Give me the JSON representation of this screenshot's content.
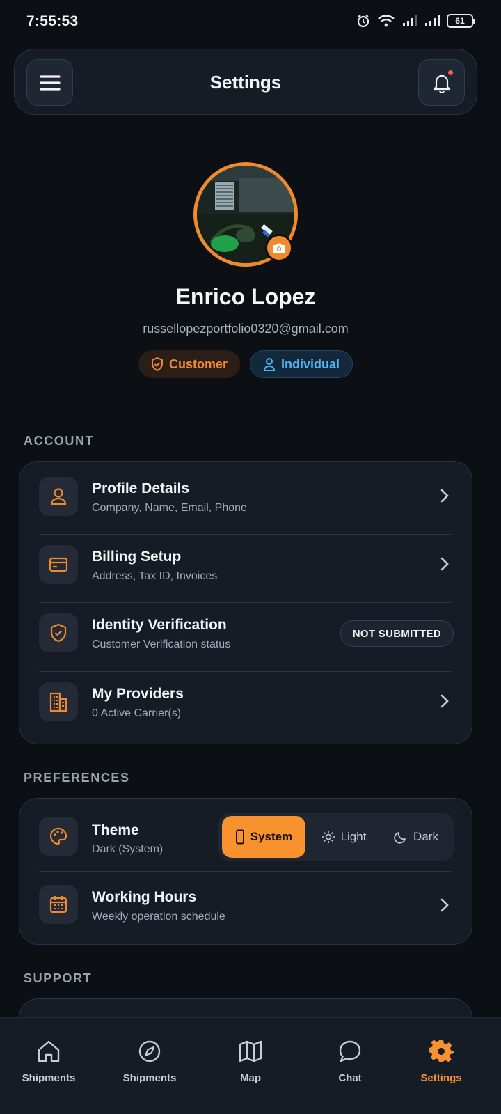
{
  "status_bar": {
    "time": "7:55:53",
    "battery": "61"
  },
  "header": {
    "title": "Settings"
  },
  "profile": {
    "name": "Enrico Lopez",
    "email": "russellopezportfolio0320@gmail.com",
    "badges": {
      "role": "Customer",
      "type": "Individual"
    }
  },
  "sections": {
    "account": {
      "label": "ACCOUNT",
      "items": [
        {
          "title": "Profile Details",
          "subtitle": "Company, Name, Email, Phone"
        },
        {
          "title": "Billing Setup",
          "subtitle": "Address, Tax ID, Invoices"
        },
        {
          "title": "Identity Verification",
          "subtitle": "Customer Verification status",
          "status": "NOT SUBMITTED"
        },
        {
          "title": "My Providers",
          "subtitle": "0 Active Carrier(s)"
        }
      ]
    },
    "preferences": {
      "label": "PREFERENCES",
      "theme": {
        "title": "Theme",
        "subtitle": "Dark (System)",
        "options": [
          "System",
          "Light",
          "Dark"
        ],
        "selected": "System"
      },
      "working_hours": {
        "title": "Working Hours",
        "subtitle": "Weekly operation schedule"
      }
    },
    "support": {
      "label": "SUPPORT"
    }
  },
  "bottom_nav": {
    "items": [
      {
        "label": "Shipments",
        "icon": "home-icon"
      },
      {
        "label": "Shipments",
        "icon": "compass-icon"
      },
      {
        "label": "Map",
        "icon": "map-icon"
      },
      {
        "label": "Chat",
        "icon": "chat-icon"
      },
      {
        "label": "Settings",
        "icon": "gear-icon",
        "active": true
      }
    ]
  },
  "colors": {
    "accent": "#f7922f",
    "info": "#4fb6f0",
    "background": "#0c1015",
    "card": "#161c26"
  }
}
